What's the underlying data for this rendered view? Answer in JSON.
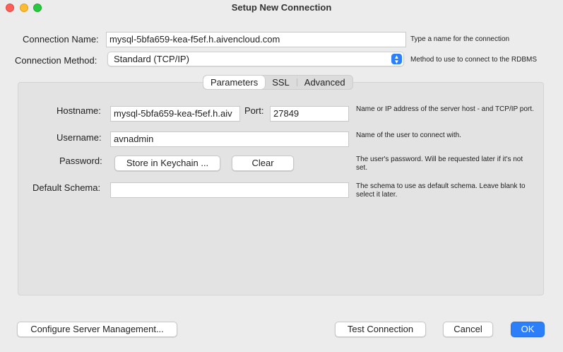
{
  "window": {
    "title": "Setup New Connection"
  },
  "connection": {
    "name_label": "Connection Name:",
    "name_value": "mysql-5bfa659-kea-f5ef.h.aivencloud.com",
    "name_hint": "Type a name for the connection",
    "method_label": "Connection Method:",
    "method_value": "Standard (TCP/IP)",
    "method_hint": "Method to use to connect to the RDBMS"
  },
  "tabs": [
    "Parameters",
    "SSL",
    "Advanced"
  ],
  "parameters": {
    "hostname_label": "Hostname:",
    "hostname_value": "mysql-5bfa659-kea-f5ef.h.aiv",
    "port_label": "Port:",
    "port_value": "27849",
    "hostname_hint": "Name or IP address of the server host - and TCP/IP port.",
    "username_label": "Username:",
    "username_value": "avnadmin",
    "username_hint": "Name of the user to connect with.",
    "password_label": "Password:",
    "store_keychain_label": "Store in Keychain ...",
    "clear_label": "Clear",
    "password_hint": "The user's password. Will be requested later if it's not set.",
    "schema_label": "Default Schema:",
    "schema_value": "",
    "schema_hint": "The schema to use as default schema. Leave blank to select it later."
  },
  "footer": {
    "configure_label": "Configure Server Management...",
    "test_label": "Test Connection",
    "cancel_label": "Cancel",
    "ok_label": "OK"
  },
  "colors": {
    "accent": "#2d7ff9",
    "close": "#fe5f57",
    "minimize": "#febc2e",
    "maximize": "#28c840"
  }
}
